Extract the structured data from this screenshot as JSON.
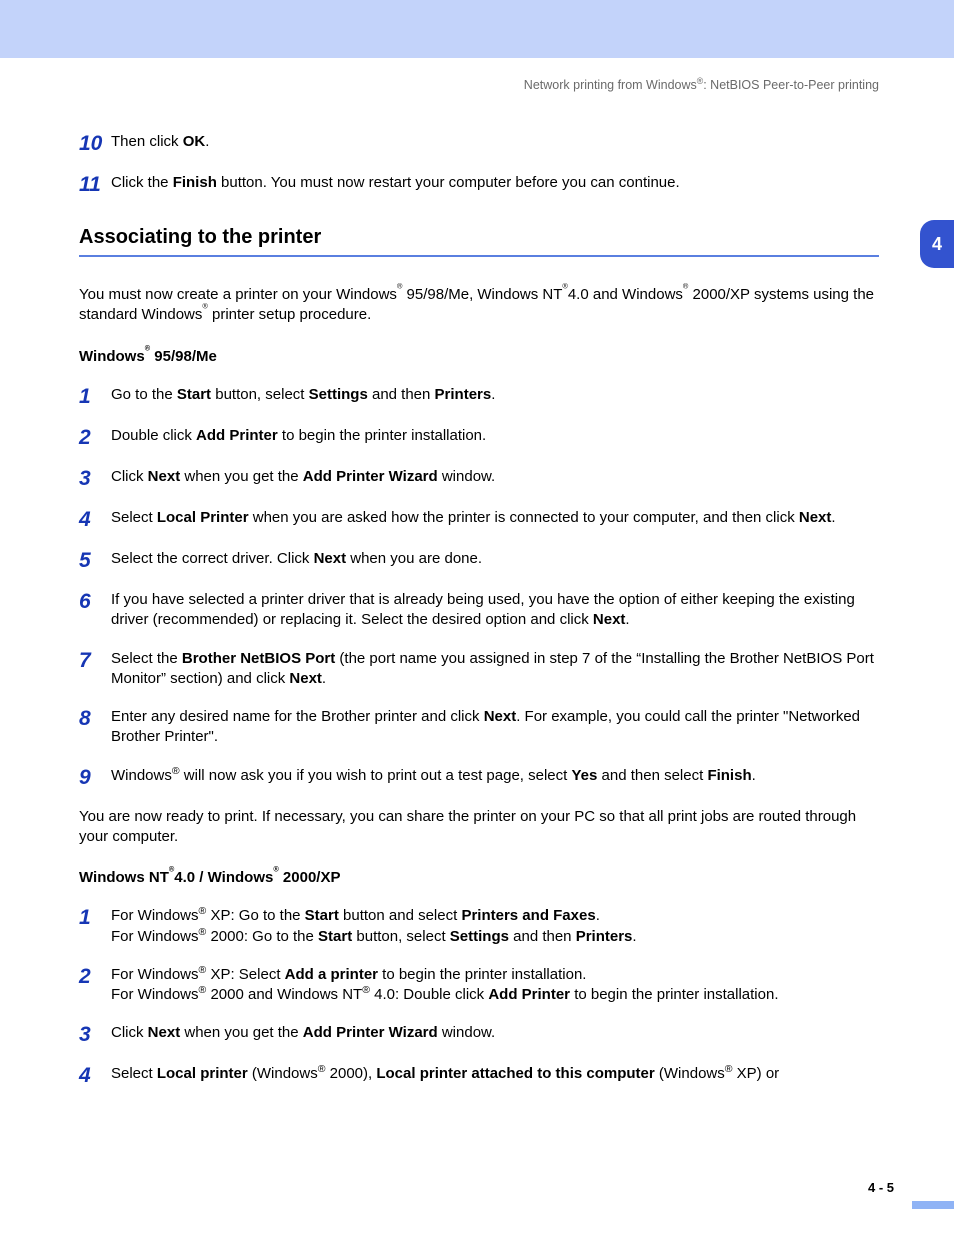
{
  "header": "Network printing from Windows®: NetBIOS Peer-to-Peer printing",
  "chapterTab": "4",
  "topSteps": [
    {
      "num": "10",
      "html": "Then click <span class='b'>OK</span>."
    },
    {
      "num": "11",
      "html": "Click the <span class='b'>Finish</span> button. You must now restart your computer before you can continue."
    }
  ],
  "sectionTitle": "Associating to the printer",
  "intro": "You must now create a printer on your Windows<sup>®</sup> 95/98/Me, Windows NT<sup>®</sup>4.0 and Windows<sup>®</sup> 2000/XP systems using the standard Windows<sup>®</sup> printer setup procedure.",
  "sub1Title": "Windows® 95/98/Me",
  "sub1Steps": [
    {
      "num": "1",
      "html": "Go to the <span class='b'>Start</span> button, select <span class='b'>Settings</span> and then <span class='b'>Printers</span>."
    },
    {
      "num": "2",
      "html": "Double click <span class='b'>Add Printer</span> to begin the printer installation."
    },
    {
      "num": "3",
      "html": "Click <span class='b'>Next</span> when you get the <span class='b'>Add Printer Wizard</span> window."
    },
    {
      "num": "4",
      "html": "Select <span class='b'>Local Printer</span> when you are asked how the printer is connected to your computer, and then click <span class='b'>Next</span>."
    },
    {
      "num": "5",
      "html": "Select the correct driver. Click <span class='b'>Next</span> when you are done."
    },
    {
      "num": "6",
      "html": "If you have selected a printer driver that is already being used, you have the option of either keeping the existing driver (recommended) or replacing it. Select the desired option and click <span class='b'>Next</span>."
    },
    {
      "num": "7",
      "html": "Select the <span class='b'>Brother NetBIOS Port</span> (the port name you assigned in step 7 of the “Installing the Brother NetBIOS Port Monitor” section) and click <span class='b'>Next</span>."
    },
    {
      "num": "8",
      "html": "Enter any desired name for the Brother printer and click <span class='b'>Next</span>. For example, you could call the printer \"Networked Brother Printer\"."
    },
    {
      "num": "9",
      "html": "Windows<sup>®</sup> will now ask you if you wish to print out a test page, select <span class='b'>Yes</span> and then select <span class='b'>Finish</span>."
    }
  ],
  "sub1After": "You are now ready to print. If necessary, you can share the printer on your PC so that all print jobs are routed through your computer.",
  "sub2Title": "Windows NT®4.0 / Windows® 2000/XP",
  "sub2Steps": [
    {
      "num": "1",
      "html": "For Windows<sup>®</sup> XP: Go to the <span class='b'>Start</span> button and select <span class='b'>Printers and Faxes</span>.<br>For Windows<sup>®</sup> 2000: Go to the <span class='b'>Start</span> button, select <span class='b'>Settings</span> and then <span class='b'>Printers</span>."
    },
    {
      "num": "2",
      "html": "For Windows<sup>®</sup> XP: Select <span class='b'>Add a printer</span> to begin the printer installation.<br>For Windows<sup>®</sup> 2000 and Windows NT<sup>®</sup> 4.0: Double click <span class='b'>Add Printer</span> to begin the printer installation."
    },
    {
      "num": "3",
      "html": "Click <span class='b'>Next</span> when you get the <span class='b'>Add Printer Wizard</span> window."
    },
    {
      "num": "4",
      "html": "Select <span class='b'>Local printer</span> (Windows<sup>®</sup> 2000), <span class='b'>Local printer attached to this computer</span> (Windows<sup>®</sup> XP) or"
    }
  ],
  "footer": "4 - 5"
}
